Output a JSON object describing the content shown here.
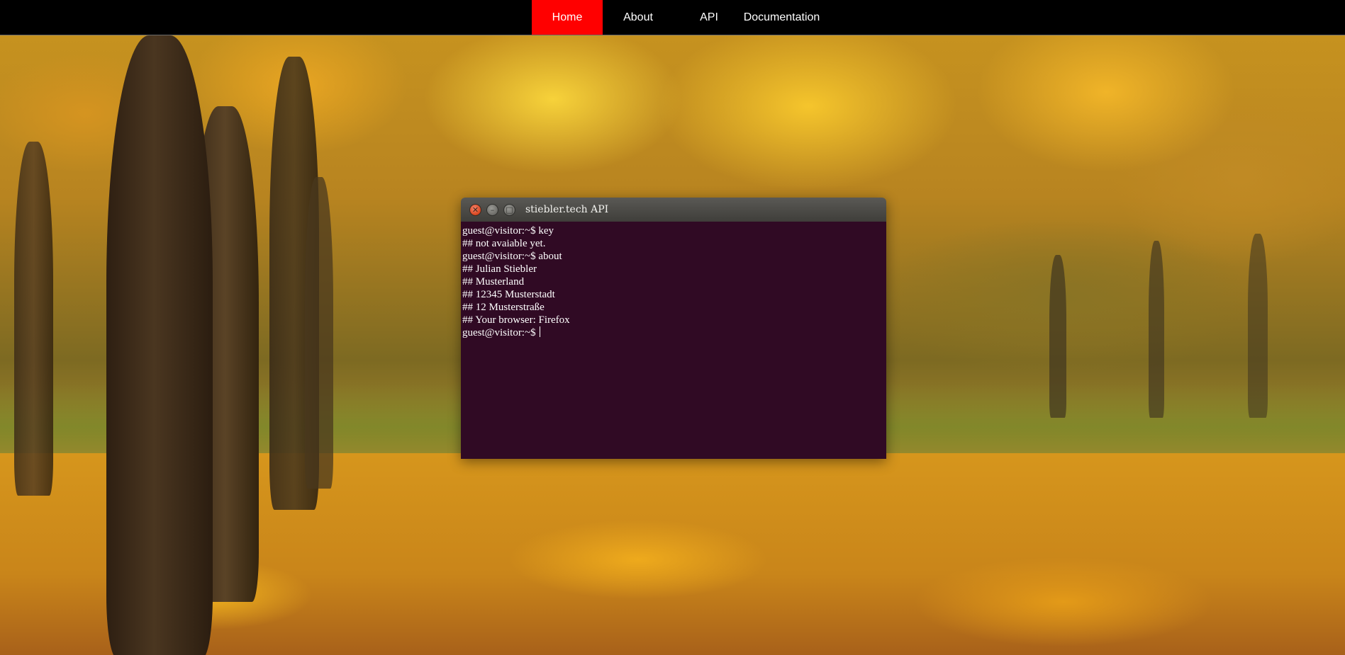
{
  "nav": {
    "items": [
      {
        "label": "Home",
        "active": true
      },
      {
        "label": "About",
        "active": false
      },
      {
        "label": "API",
        "active": false
      },
      {
        "label": "Documentation",
        "active": false
      }
    ],
    "active_color": "#ff0000"
  },
  "terminal": {
    "title": "stiebler.tech API",
    "buttons": {
      "close": "close-icon",
      "minimize": "minimize-icon",
      "maximize": "maximize-icon"
    },
    "background": "#300a24",
    "lines": [
      "guest@visitor:~$ key",
      "## not avaiable yet.",
      "guest@visitor:~$ about",
      "## Julian Stiebler",
      "## Musterland",
      "## 12345 Musterstadt",
      "## 12 Musterstraße",
      "## Your browser: Firefox"
    ],
    "prompt": "guest@visitor:~$ ",
    "input_value": ""
  }
}
